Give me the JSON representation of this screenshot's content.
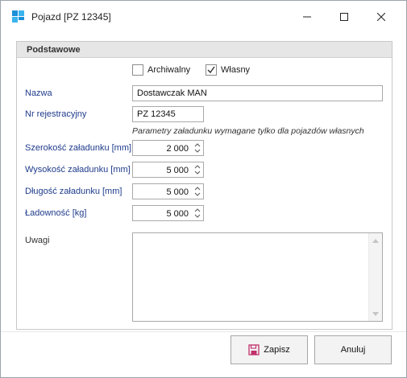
{
  "window": {
    "title": "Pojazd [PZ 12345]",
    "icon": "app-grid-icon",
    "controls": [
      "minimize-icon",
      "maximize-icon",
      "close-icon"
    ]
  },
  "group": {
    "title": "Podstawowe"
  },
  "checkboxes": {
    "archiwalny": {
      "label": "Archiwalny",
      "checked": false
    },
    "wlasny": {
      "label": "Własny",
      "checked": true
    }
  },
  "fields": {
    "nazwa": {
      "label": "Nazwa",
      "value": "Dostawczak MAN"
    },
    "nr_rej": {
      "label": "Nr rejestracyjny",
      "value": "PZ 12345"
    },
    "hint": "Parametry załadunku wymagane tylko dla pojazdów własnych",
    "szerokosc": {
      "label": "Szerokość załadunku [mm]",
      "value": "2 000"
    },
    "wysokosc": {
      "label": "Wysokość załadunku [mm]",
      "value": "5 000"
    },
    "dlugosc": {
      "label": "Długość załadunku [mm]",
      "value": "5 000"
    },
    "ladownosc": {
      "label": "Ładowność [kg]",
      "value": "5 000"
    },
    "uwagi": {
      "label": "Uwagi",
      "value": ""
    }
  },
  "buttons": {
    "save": "Zapisz",
    "cancel": "Anuluj"
  },
  "colors": {
    "label_blue": "#1f3b8c",
    "group_header": "#e6e6e6",
    "button_bg": "#f3f3f3",
    "save_icon": "#c0306a"
  }
}
